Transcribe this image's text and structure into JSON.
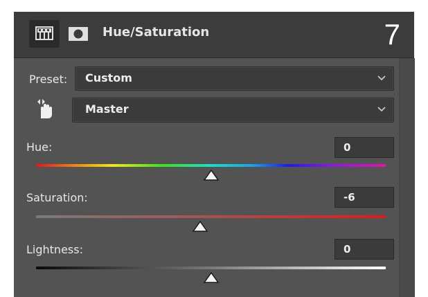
{
  "header": {
    "title": "Hue/Saturation",
    "step_number": "7",
    "icons": [
      "adjustment-layer-icon",
      "layer-mask-icon"
    ]
  },
  "preset": {
    "label": "Preset:",
    "value": "Custom"
  },
  "channel": {
    "value": "Master",
    "tool_icon": "on-image-adjust-hand-icon"
  },
  "sliders": {
    "hue": {
      "label": "Hue:",
      "value": "0",
      "level": 0
    },
    "saturation": {
      "label": "Saturation:",
      "value": "-6",
      "level": -6
    },
    "lightness": {
      "label": "Lightness:",
      "value": "0",
      "level": 0
    }
  },
  "colors": {
    "panel_bg": "#535353",
    "header_bg": "#3c3c3c",
    "field_bg": "#3b3b3b",
    "text": "#e8e8e8",
    "saturation_end": "#e21a1a"
  }
}
